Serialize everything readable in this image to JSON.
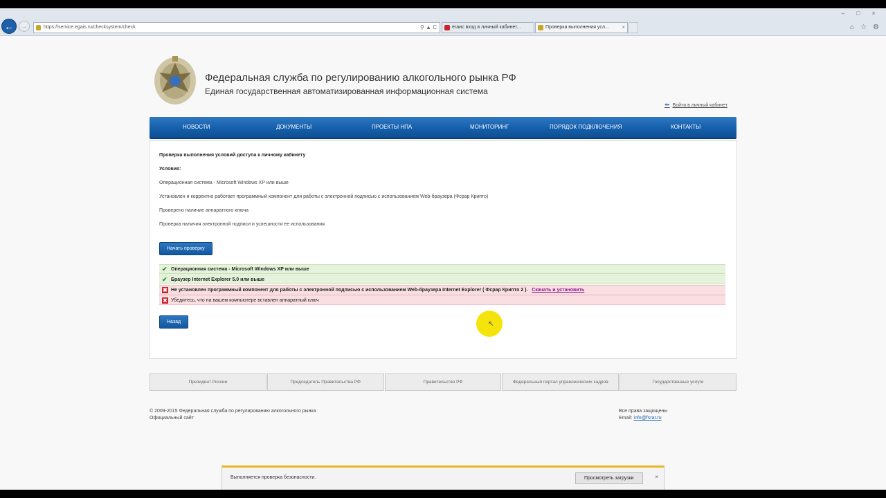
{
  "browser": {
    "url": "https://service.egais.ru/checksystem/check",
    "tabs": [
      {
        "label": "егаис вход в личный кабинет...",
        "close": "×"
      },
      {
        "label": "Проверка выполнения усл...",
        "close": "×"
      }
    ],
    "window_controls": [
      "–",
      "□",
      "×"
    ]
  },
  "header": {
    "title": "Федеральная служба по регулированию алкогольного рынка РФ",
    "subtitle": "Единая государственная автоматизированная информационная система",
    "login_link": "Войти в личный кабинет"
  },
  "nav": {
    "items": [
      "НОВОСТИ",
      "ДОКУМЕНТЫ",
      "ПРОЕКТЫ НПА",
      "МОНИТОРИНГ",
      "ПОРЯДОК ПОДКЛЮЧЕНИЯ",
      "КОНТАКТЫ"
    ]
  },
  "main": {
    "heading": "Проверка выполнения условий доступа к личному кабинету",
    "conditions_label": "Условия:",
    "conditions": [
      "Операционная система - Microsoft Windows XP или выше",
      "Установлен и корректно работает программный компонент для работы с электронной подписью с использованием Web-браузера (Фсрар Крипто)",
      "Проверено наличие аппаратного ключа",
      "Проверка наличия электронной подписи и успешности ее использования"
    ],
    "start_button": "Начать проверку",
    "results": [
      {
        "status": "ok",
        "text": "Операционная система - Microsoft Windows XP или выше"
      },
      {
        "status": "ok",
        "text": "Браузер Internet Explorer 5.0 или выше"
      },
      {
        "status": "error",
        "text": "Не установлен программный компонент для работы с электронной подписью с использованием Web-браузера Internet Explorer ( Фсрар Крипто 2 ).",
        "link": "Скачать и установить"
      },
      {
        "status": "error",
        "text": "Убедитесь, что на вашем компьютере вставлен аппаратный ключ"
      }
    ],
    "back_button": "Назад"
  },
  "footer": {
    "links": [
      "Президент России",
      "Председатель Правительства РФ",
      "Правительство РФ",
      "Федеральный портал управленческих кадров",
      "Государственные услуги"
    ],
    "copyright": "© 2009-2015 Федеральная служба по регулированию алкогольного рынка",
    "official": "Официальный сайт",
    "rights": "Все права защищены",
    "email_label": "Email:",
    "email": "info@fsrar.ru"
  },
  "notification": {
    "text": "Выполняется проверка безопасности.",
    "button": "Просмотреть загрузки",
    "close": "×"
  },
  "colors": {
    "nav_blue": "#155fab",
    "ok_bg": "#e5f3dc",
    "error_bg": "#f9dfe2",
    "notif_accent": "#e8b624"
  }
}
